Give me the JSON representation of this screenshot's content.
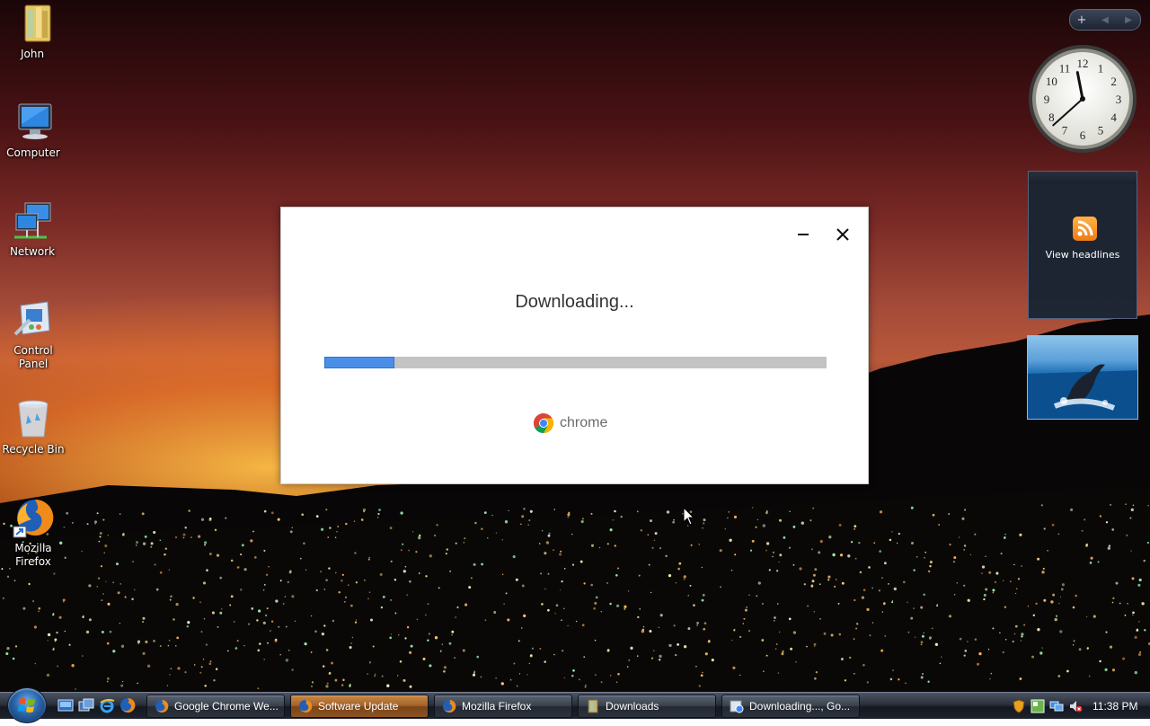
{
  "desktop_icons": [
    {
      "label": "John",
      "icon": "user-folder-icon"
    },
    {
      "label": "Computer",
      "icon": "computer-icon"
    },
    {
      "label": "Network",
      "icon": "network-icon"
    },
    {
      "label": "Control Panel",
      "icon": "control-panel-icon"
    },
    {
      "label": "Recycle Bin",
      "icon": "recycle-bin-icon"
    },
    {
      "label": "Mozilla Firefox",
      "icon": "firefox-icon"
    }
  ],
  "gadgets": {
    "controls": {
      "add": "+",
      "prev": "◀",
      "next": "▶"
    },
    "clock": {
      "hour": 11,
      "minute": 38
    },
    "feed": {
      "label": "View headlines",
      "icon": "rss-icon"
    },
    "slideshow": {
      "icon": "whale-photo"
    }
  },
  "installer": {
    "status": "Downloading...",
    "progress": 0.14,
    "brand": "chrome",
    "minimize_icon": "minimize-icon",
    "close_icon": "close-icon",
    "accent_color": "#4a8fe7"
  },
  "taskbar": {
    "tasks": [
      {
        "label": "Google Chrome We...",
        "icon": "firefox-icon",
        "active": false
      },
      {
        "label": "Software Update",
        "icon": "firefox-icon",
        "active": true
      },
      {
        "label": "Mozilla Firefox",
        "icon": "firefox-icon",
        "active": false
      },
      {
        "label": "Downloads",
        "icon": "folder-icon",
        "active": false
      },
      {
        "label": "Downloading..., Go...",
        "icon": "installer-icon",
        "active": false
      }
    ],
    "quick_launch": [
      "show-desktop-icon",
      "switch-windows-icon",
      "internet-explorer-icon",
      "firefox-icon"
    ],
    "tray": {
      "time": "11:38 PM"
    }
  }
}
